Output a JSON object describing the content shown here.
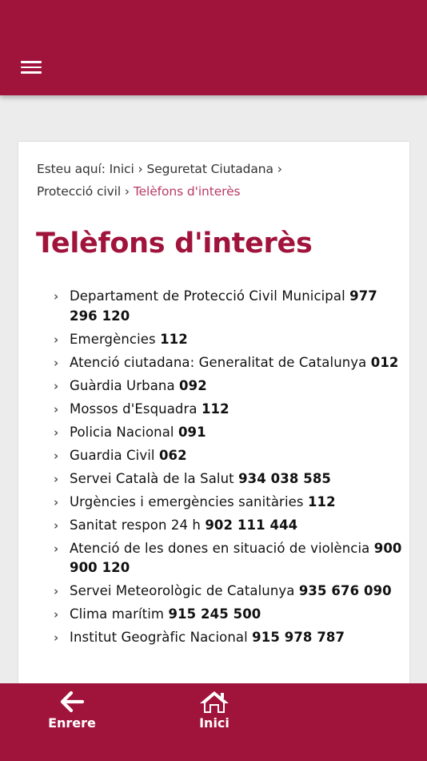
{
  "breadcrumb": {
    "prefix": "Esteu aquí:",
    "items": [
      "Inici",
      "Seguretat Ciutadana",
      "Protecció civil"
    ],
    "separator": "›",
    "current": "Telèfons d'interès"
  },
  "page_title": "Telèfons d'interès",
  "phones": [
    {
      "label": "Departament de Protecció Civil Municipal",
      "number": "977 296 120"
    },
    {
      "label": "Emergències",
      "number": "112"
    },
    {
      "label": "Atenció ciutadana: Generalitat de Catalunya",
      "number": "012"
    },
    {
      "label": "Guàrdia Urbana",
      "number": "092"
    },
    {
      "label": "Mossos d'Esquadra",
      "number": "112"
    },
    {
      "label": "Policia Nacional",
      "number": "091"
    },
    {
      "label": "Guardia Civil",
      "number": "062"
    },
    {
      "label": "Servei Català de la Salut",
      "number": "934 038 585"
    },
    {
      "label": "Urgències i emergències sanitàries",
      "number": "112"
    },
    {
      "label": "Sanitat respon 24 h",
      "number": "902 111 444"
    },
    {
      "label": "Atenció de les dones en situació de violència",
      "number": "900 900 120"
    },
    {
      "label": "Servei Meteorològic de Catalunya",
      "number": "935 676 090"
    },
    {
      "label": "Clima marítim",
      "number": "915 245 500"
    },
    {
      "label": "Institut Geogràfic Nacional",
      "number": "915 978 787"
    }
  ],
  "bottom_nav": {
    "back_label": "Enrere",
    "back_icon": "arrow-left-icon",
    "home_label": "Inici",
    "home_icon": "home-icon"
  },
  "colors": {
    "brand": "#a0143c",
    "breadcrumb_current": "#b93a63",
    "background": "#ececec"
  }
}
